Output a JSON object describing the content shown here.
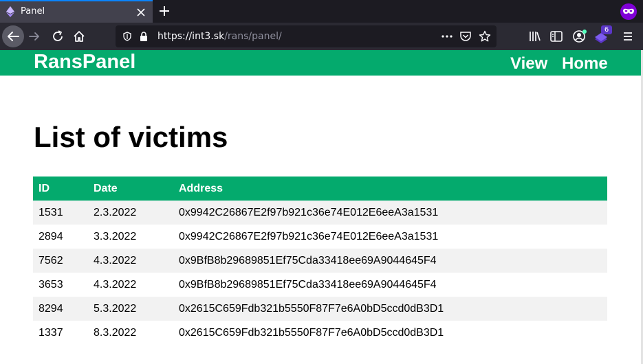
{
  "browser": {
    "tab_title": "Panel",
    "url_host": "https://int3.sk",
    "url_path": "/rans/panel/",
    "extension_badge": "6",
    "icons": {
      "tab_favicon": "ethereum-icon",
      "tab_close": "close-icon",
      "new_tab": "plus-icon",
      "private_browsing": "private-mask-icon",
      "back": "arrow-left-icon",
      "forward": "arrow-right-icon",
      "reload": "reload-icon",
      "home": "home-icon",
      "tracking_protection": "shield-icon",
      "secure": "lock-icon",
      "page_actions": "more-dots-icon",
      "pocket": "pocket-icon",
      "bookmark": "star-icon",
      "library": "library-icon",
      "sidebar": "sidebar-icon",
      "account": "account-icon",
      "extension": "extension-icon",
      "menu": "hamburger-menu-icon"
    }
  },
  "site": {
    "brand": "RansPanel",
    "nav": {
      "view": "View",
      "home": "Home"
    },
    "accent_color": "#04aa6d"
  },
  "main": {
    "heading": "List of victims",
    "table": {
      "headers": {
        "id": "ID",
        "date": "Date",
        "address": "Address"
      },
      "rows": [
        {
          "id": "1531",
          "date": "2.3.2022",
          "address": "0x9942C26867E2f97b921c36e74E012E6eeA3a1531"
        },
        {
          "id": "2894",
          "date": "3.3.2022",
          "address": "0x9942C26867E2f97b921c36e74E012E6eeA3a1531"
        },
        {
          "id": "7562",
          "date": "4.3.2022",
          "address": "0x9BfB8b29689851Ef75Cda33418ee69A9044645F4"
        },
        {
          "id": "3653",
          "date": "4.3.2022",
          "address": "0x9BfB8b29689851Ef75Cda33418ee69A9044645F4"
        },
        {
          "id": "8294",
          "date": "5.3.2022",
          "address": "0x2615C659Fdb321b5550F87F7e6A0bD5ccd0dB3D1"
        },
        {
          "id": "1337",
          "date": "8.3.2022",
          "address": "0x2615C659Fdb321b5550F87F7e6A0bD5ccd0dB3D1"
        }
      ]
    }
  }
}
